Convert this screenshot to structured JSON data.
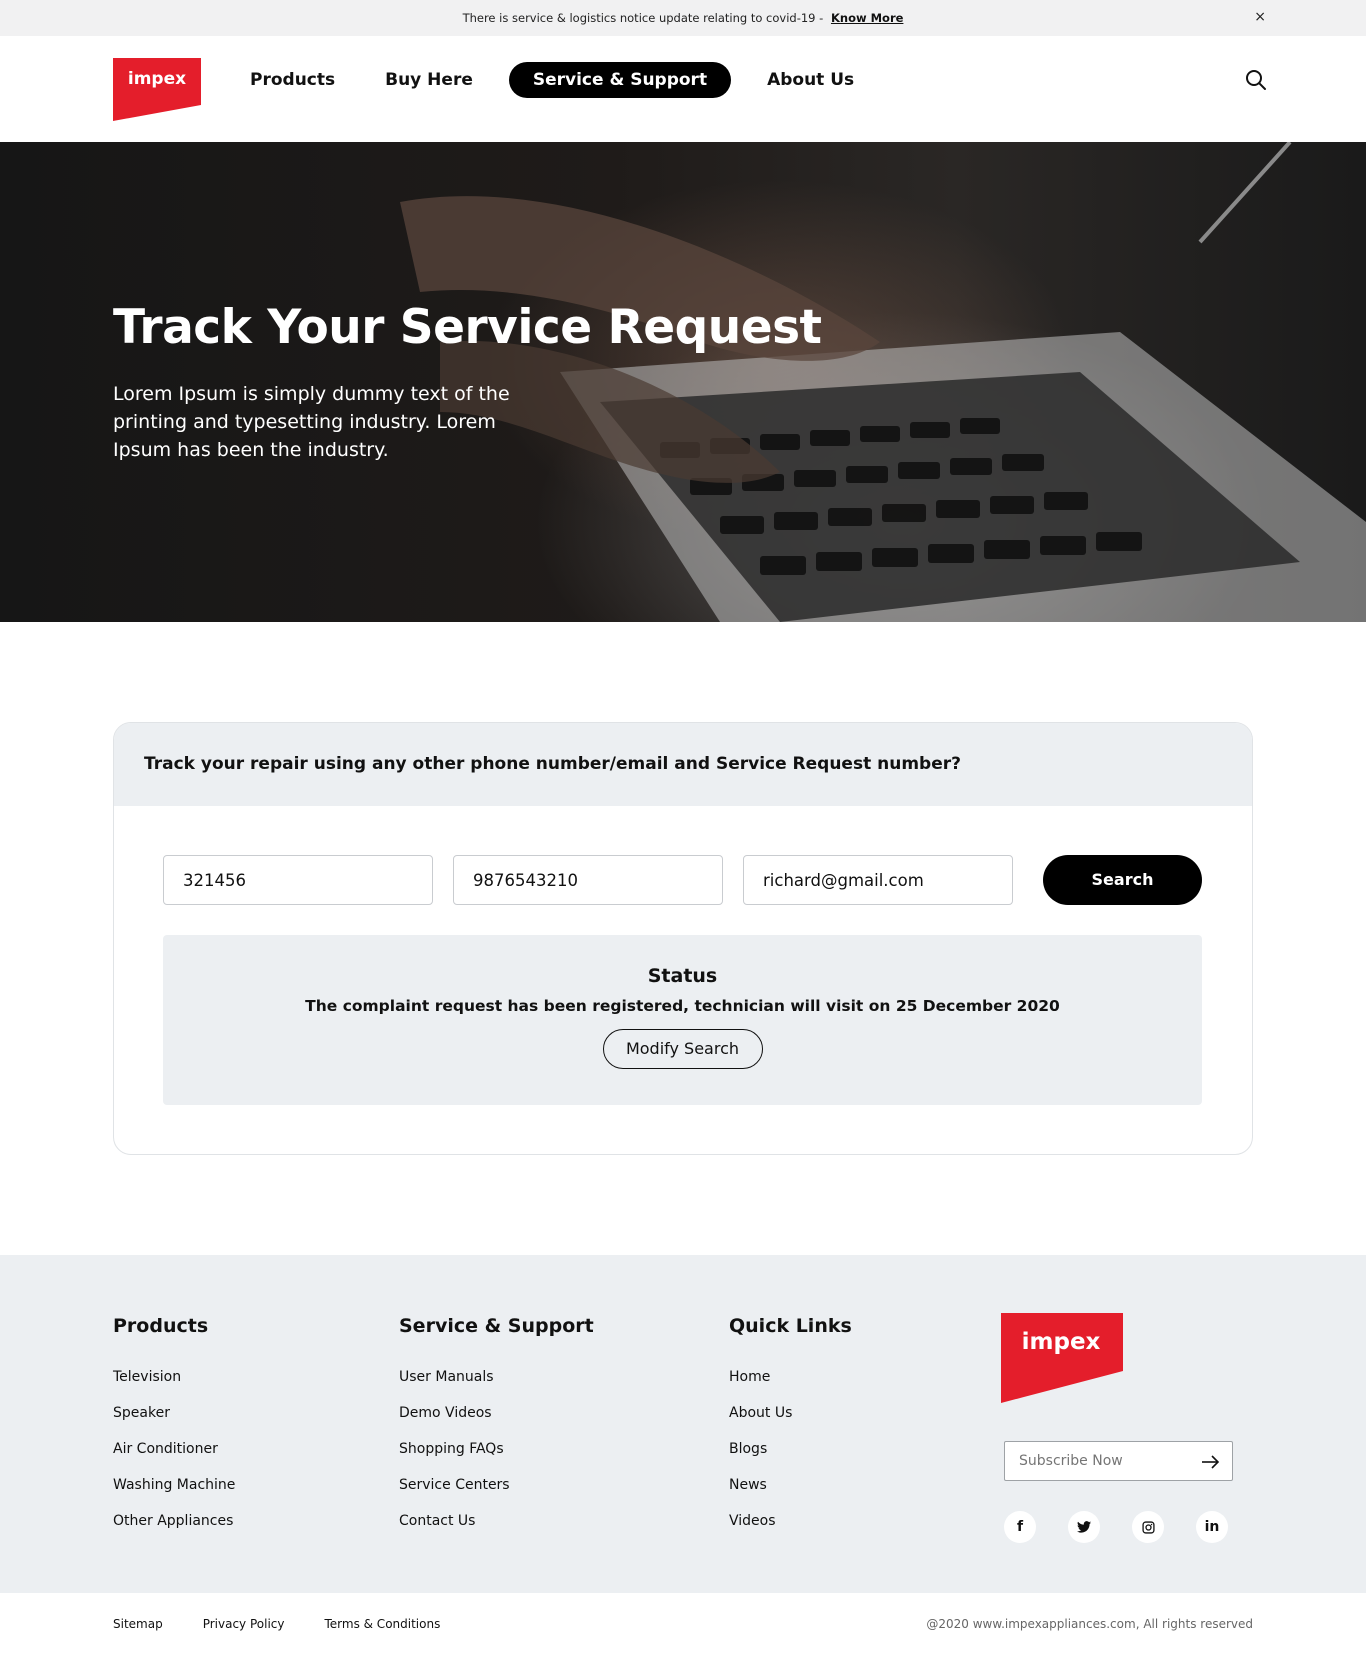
{
  "notice": {
    "text": "There is service & logistics notice update relating to covid-19  -",
    "link": "Know More",
    "close": "×"
  },
  "header": {
    "logo_text": "impex",
    "nav": [
      {
        "label": "Products"
      },
      {
        "label": "Buy Here"
      },
      {
        "label": "Service & Support",
        "active": true
      },
      {
        "label": "About Us"
      }
    ]
  },
  "hero": {
    "title": "Track Your Service Request",
    "description": "Lorem Ipsum is simply dummy text of the printing and typesetting industry. Lorem Ipsum has been the industry."
  },
  "track": {
    "heading": "Track your repair using any other phone number/email and Service Request number?",
    "request_number": "321456",
    "phone": "9876543210",
    "email": "richard@gmail.com",
    "search_label": "Search",
    "status_title": "Status",
    "status_message": "The complaint request has been registered, technician will visit on 25 December 2020",
    "modify_label": "Modify Search"
  },
  "footer": {
    "products": {
      "title": "Products",
      "links": [
        "Television",
        "Speaker",
        "Air Conditioner",
        "Washing Machine",
        "Other Appliances"
      ]
    },
    "service": {
      "title": "Service & Support",
      "links": [
        "User Manuals",
        "Demo Videos",
        "Shopping FAQs",
        "Service Centers",
        "Contact Us"
      ]
    },
    "quick": {
      "title": "Quick Links",
      "links": [
        "Home",
        "About Us",
        "Blogs",
        "News",
        "Videos"
      ]
    },
    "subscribe_placeholder": "Subscribe Now",
    "socials": [
      "f",
      "t",
      "ig",
      "in"
    ]
  },
  "bottom": {
    "links": [
      "Sitemap",
      "Privacy Policy",
      "Terms & Conditions"
    ],
    "copyright": "@2020 www.impexappliances.com, All rights reserved"
  },
  "colors": {
    "brand_red": "#e41e2b",
    "black": "#000000",
    "panel": "#eceff2"
  }
}
